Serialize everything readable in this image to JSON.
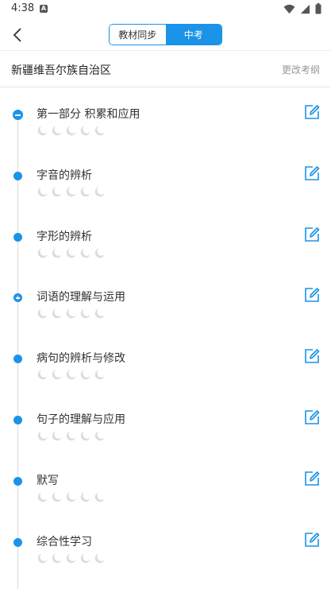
{
  "status": {
    "time": "4:38",
    "notif": "A"
  },
  "nav": {
    "tabs": [
      "教材同步",
      "中考"
    ],
    "active_tab": 1
  },
  "region": {
    "name": "新疆维吾尔族自治区",
    "change_label": "更改考纲"
  },
  "items": [
    {
      "title": "第一部分 积累和应用",
      "marker": "minus",
      "stars": 5
    },
    {
      "title": "字音的辨析",
      "marker": "dot",
      "stars": 5
    },
    {
      "title": "字形的辨析",
      "marker": "dot",
      "stars": 5
    },
    {
      "title": "词语的理解与运用",
      "marker": "plus",
      "stars": 5
    },
    {
      "title": "病句的辨析与修改",
      "marker": "dot",
      "stars": 5
    },
    {
      "title": "句子的理解与应用",
      "marker": "dot",
      "stars": 5
    },
    {
      "title": "默写",
      "marker": "dot",
      "stars": 5
    },
    {
      "title": "综合性学习",
      "marker": "dot",
      "stars": 5
    }
  ],
  "colors": {
    "accent": "#1a93e8",
    "moon": "#dcdcdc"
  },
  "icons": {
    "back": "chevron-left-icon",
    "edit": "edit-square-icon",
    "rating": "crescent-moon-icon"
  }
}
